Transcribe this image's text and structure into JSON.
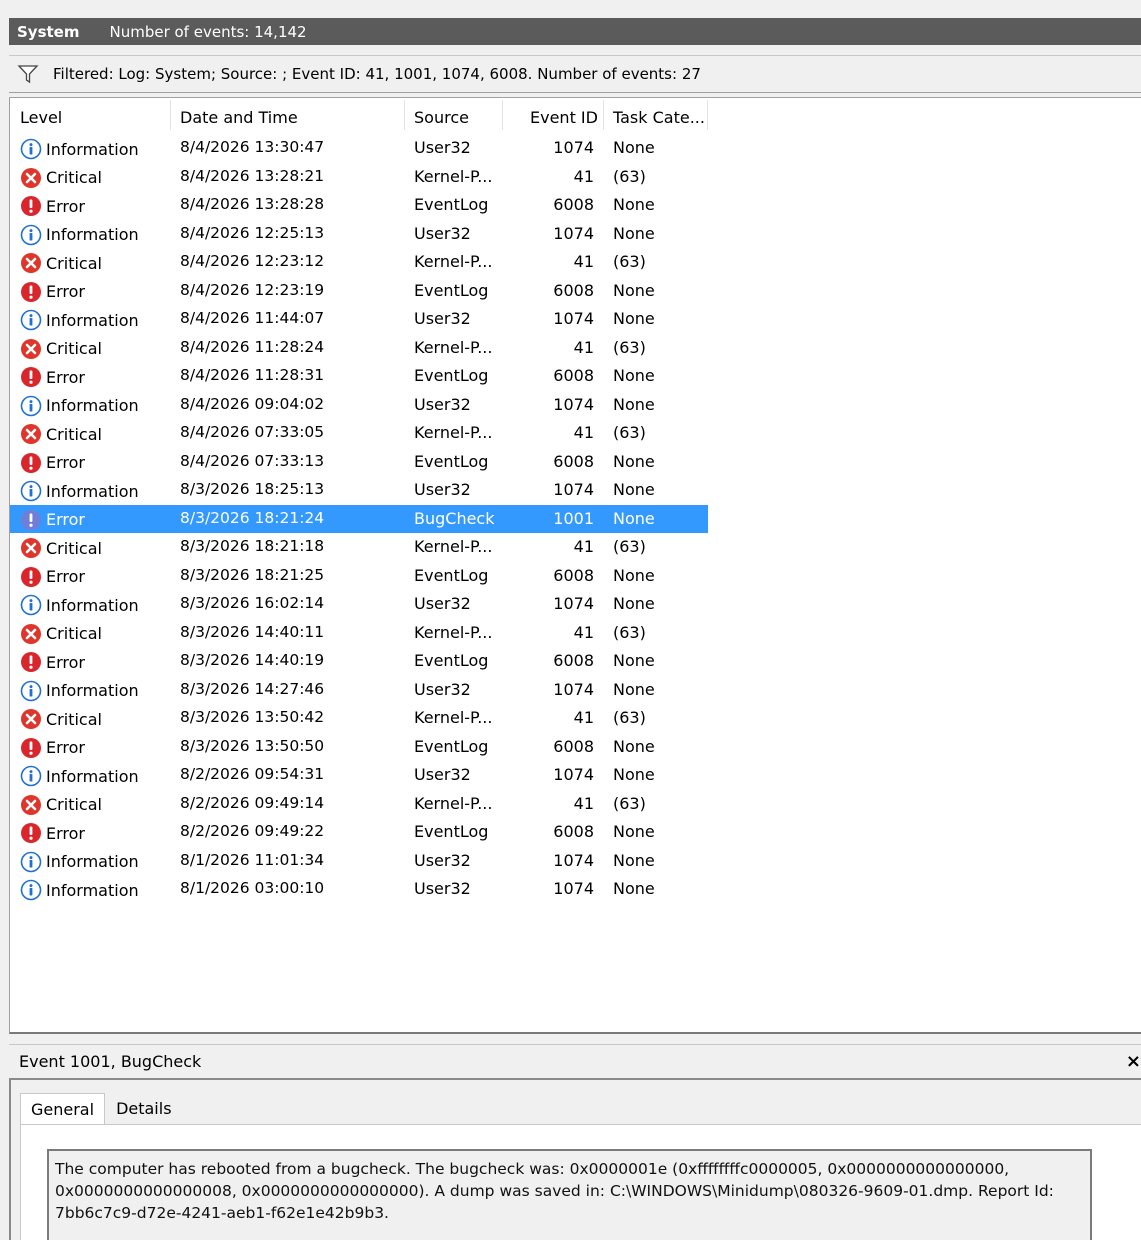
{
  "titlebar": {
    "log_name": "System",
    "event_count": "Number of events: 14,142"
  },
  "filter": {
    "text": "Filtered: Log: System; Source: ; Event ID: 41, 1001, 1074, 6008. Number of events: 27"
  },
  "columns": {
    "level": "Level",
    "date": "Date and Time",
    "source": "Source",
    "event_id": "Event ID",
    "task": "Task Cate..."
  },
  "rows": [
    {
      "level": "Information",
      "icon": "info",
      "date": "8/4/2026 13:30:47",
      "source": "User32",
      "event_id": "1074",
      "task": "None"
    },
    {
      "level": "Critical",
      "icon": "critical",
      "date": "8/4/2026 13:28:21",
      "source": "Kernel-P...",
      "event_id": "41",
      "task": "(63)"
    },
    {
      "level": "Error",
      "icon": "error",
      "date": "8/4/2026 13:28:28",
      "source": "EventLog",
      "event_id": "6008",
      "task": "None"
    },
    {
      "level": "Information",
      "icon": "info",
      "date": "8/4/2026 12:25:13",
      "source": "User32",
      "event_id": "1074",
      "task": "None"
    },
    {
      "level": "Critical",
      "icon": "critical",
      "date": "8/4/2026 12:23:12",
      "source": "Kernel-P...",
      "event_id": "41",
      "task": "(63)"
    },
    {
      "level": "Error",
      "icon": "error",
      "date": "8/4/2026 12:23:19",
      "source": "EventLog",
      "event_id": "6008",
      "task": "None"
    },
    {
      "level": "Information",
      "icon": "info",
      "date": "8/4/2026 11:44:07",
      "source": "User32",
      "event_id": "1074",
      "task": "None"
    },
    {
      "level": "Critical",
      "icon": "critical",
      "date": "8/4/2026 11:28:24",
      "source": "Kernel-P...",
      "event_id": "41",
      "task": "(63)"
    },
    {
      "level": "Error",
      "icon": "error",
      "date": "8/4/2026 11:28:31",
      "source": "EventLog",
      "event_id": "6008",
      "task": "None"
    },
    {
      "level": "Information",
      "icon": "info",
      "date": "8/4/2026 09:04:02",
      "source": "User32",
      "event_id": "1074",
      "task": "None"
    },
    {
      "level": "Critical",
      "icon": "critical",
      "date": "8/4/2026 07:33:05",
      "source": "Kernel-P...",
      "event_id": "41",
      "task": "(63)"
    },
    {
      "level": "Error",
      "icon": "error",
      "date": "8/4/2026 07:33:13",
      "source": "EventLog",
      "event_id": "6008",
      "task": "None"
    },
    {
      "level": "Information",
      "icon": "info",
      "date": "8/3/2026 18:25:13",
      "source": "User32",
      "event_id": "1074",
      "task": "None"
    },
    {
      "level": "Error",
      "icon": "error",
      "date": "8/3/2026 18:21:24",
      "source": "BugCheck",
      "event_id": "1001",
      "task": "None",
      "selected": true
    },
    {
      "level": "Critical",
      "icon": "critical",
      "date": "8/3/2026 18:21:18",
      "source": "Kernel-P...",
      "event_id": "41",
      "task": "(63)"
    },
    {
      "level": "Error",
      "icon": "error",
      "date": "8/3/2026 18:21:25",
      "source": "EventLog",
      "event_id": "6008",
      "task": "None"
    },
    {
      "level": "Information",
      "icon": "info",
      "date": "8/3/2026 16:02:14",
      "source": "User32",
      "event_id": "1074",
      "task": "None"
    },
    {
      "level": "Critical",
      "icon": "critical",
      "date": "8/3/2026 14:40:11",
      "source": "Kernel-P...",
      "event_id": "41",
      "task": "(63)"
    },
    {
      "level": "Error",
      "icon": "error",
      "date": "8/3/2026 14:40:19",
      "source": "EventLog",
      "event_id": "6008",
      "task": "None"
    },
    {
      "level": "Information",
      "icon": "info",
      "date": "8/3/2026 14:27:46",
      "source": "User32",
      "event_id": "1074",
      "task": "None"
    },
    {
      "level": "Critical",
      "icon": "critical",
      "date": "8/3/2026 13:50:42",
      "source": "Kernel-P...",
      "event_id": "41",
      "task": "(63)"
    },
    {
      "level": "Error",
      "icon": "error",
      "date": "8/3/2026 13:50:50",
      "source": "EventLog",
      "event_id": "6008",
      "task": "None"
    },
    {
      "level": "Information",
      "icon": "info",
      "date": "8/2/2026 09:54:31",
      "source": "User32",
      "event_id": "1074",
      "task": "None"
    },
    {
      "level": "Critical",
      "icon": "critical",
      "date": "8/2/2026 09:49:14",
      "source": "Kernel-P...",
      "event_id": "41",
      "task": "(63)"
    },
    {
      "level": "Error",
      "icon": "error",
      "date": "8/2/2026 09:49:22",
      "source": "EventLog",
      "event_id": "6008",
      "task": "None"
    },
    {
      "level": "Information",
      "icon": "info",
      "date": "8/1/2026 11:01:34",
      "source": "User32",
      "event_id": "1074",
      "task": "None"
    },
    {
      "level": "Information",
      "icon": "info",
      "date": "8/1/2026 03:00:10",
      "source": "User32",
      "event_id": "1074",
      "task": "None"
    }
  ],
  "detail": {
    "header": "Event 1001, BugCheck",
    "close": "×",
    "tabs": [
      "General",
      "Details"
    ],
    "description": "The computer has rebooted from a bugcheck.  The bugcheck was: 0x0000001e (0xffffffffc0000005, 0x0000000000000000, 0x0000000000000008, 0x0000000000000000). A dump was saved in: C:\\WINDOWS\\Minidump\\080326-9609-01.dmp. Report Id: 7bb6c7c9-d72e-4241-aeb1-f62e1e42b9b3."
  },
  "colors": {
    "selection": "#3399ff",
    "titlebar": "#5b5b5b",
    "critical": "#e0352b",
    "error": "#d9262c",
    "info": "#1f6fd6"
  }
}
